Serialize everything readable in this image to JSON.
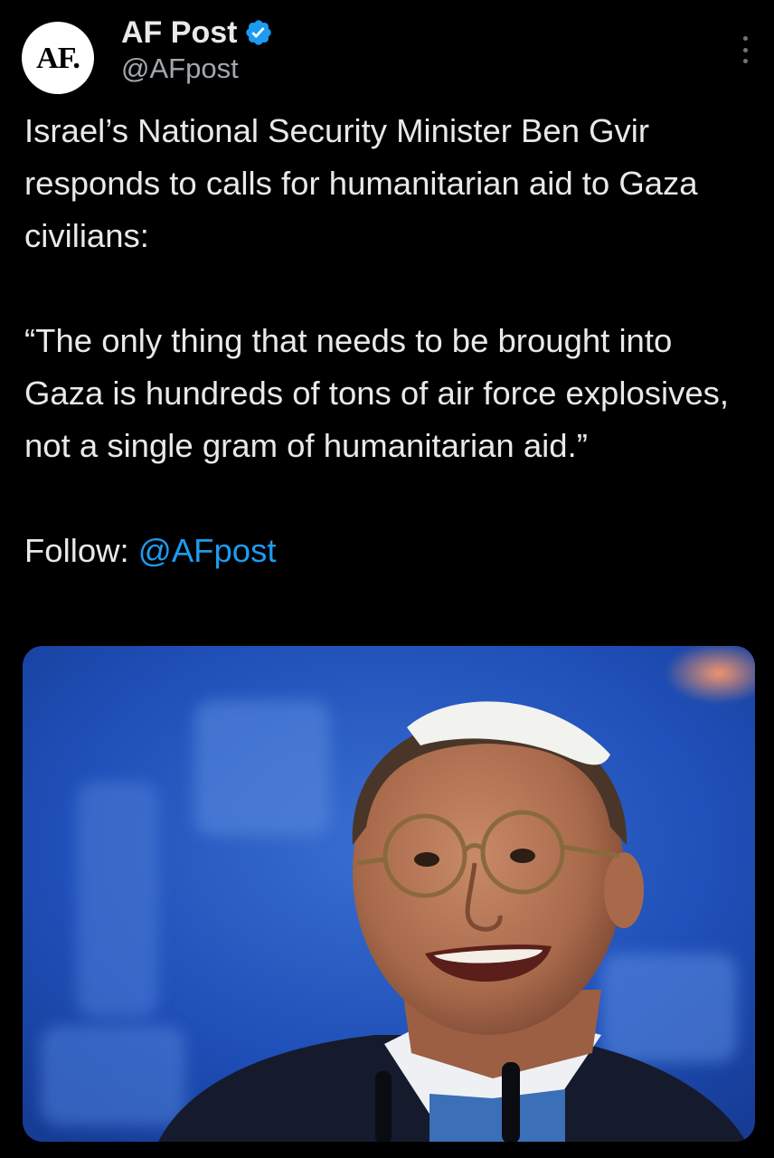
{
  "author": {
    "avatar_text": "AF.",
    "display_name": "AF Post",
    "handle": "@AFpost",
    "verified": true
  },
  "tweet": {
    "paragraph_1": "Israel’s National Security Minister Ben Gvir responds to calls for humanitarian aid to Gaza civilians:",
    "paragraph_2": "“The only thing that needs to be brought into Gaza is hundreds of tons of air force explosives, not a single gram of humanitarian aid.”",
    "follow_label": "Follow:",
    "follow_mention": "@AFpost"
  },
  "media": {
    "subject": "smiling man in white kippah and round glasses at podium with microphones"
  },
  "colors": {
    "background": "#000000",
    "text": "#e7e9ea",
    "secondary": "#a3a8ad",
    "link": "#1d9bf0",
    "verified_badge": "#1d9bf0"
  }
}
